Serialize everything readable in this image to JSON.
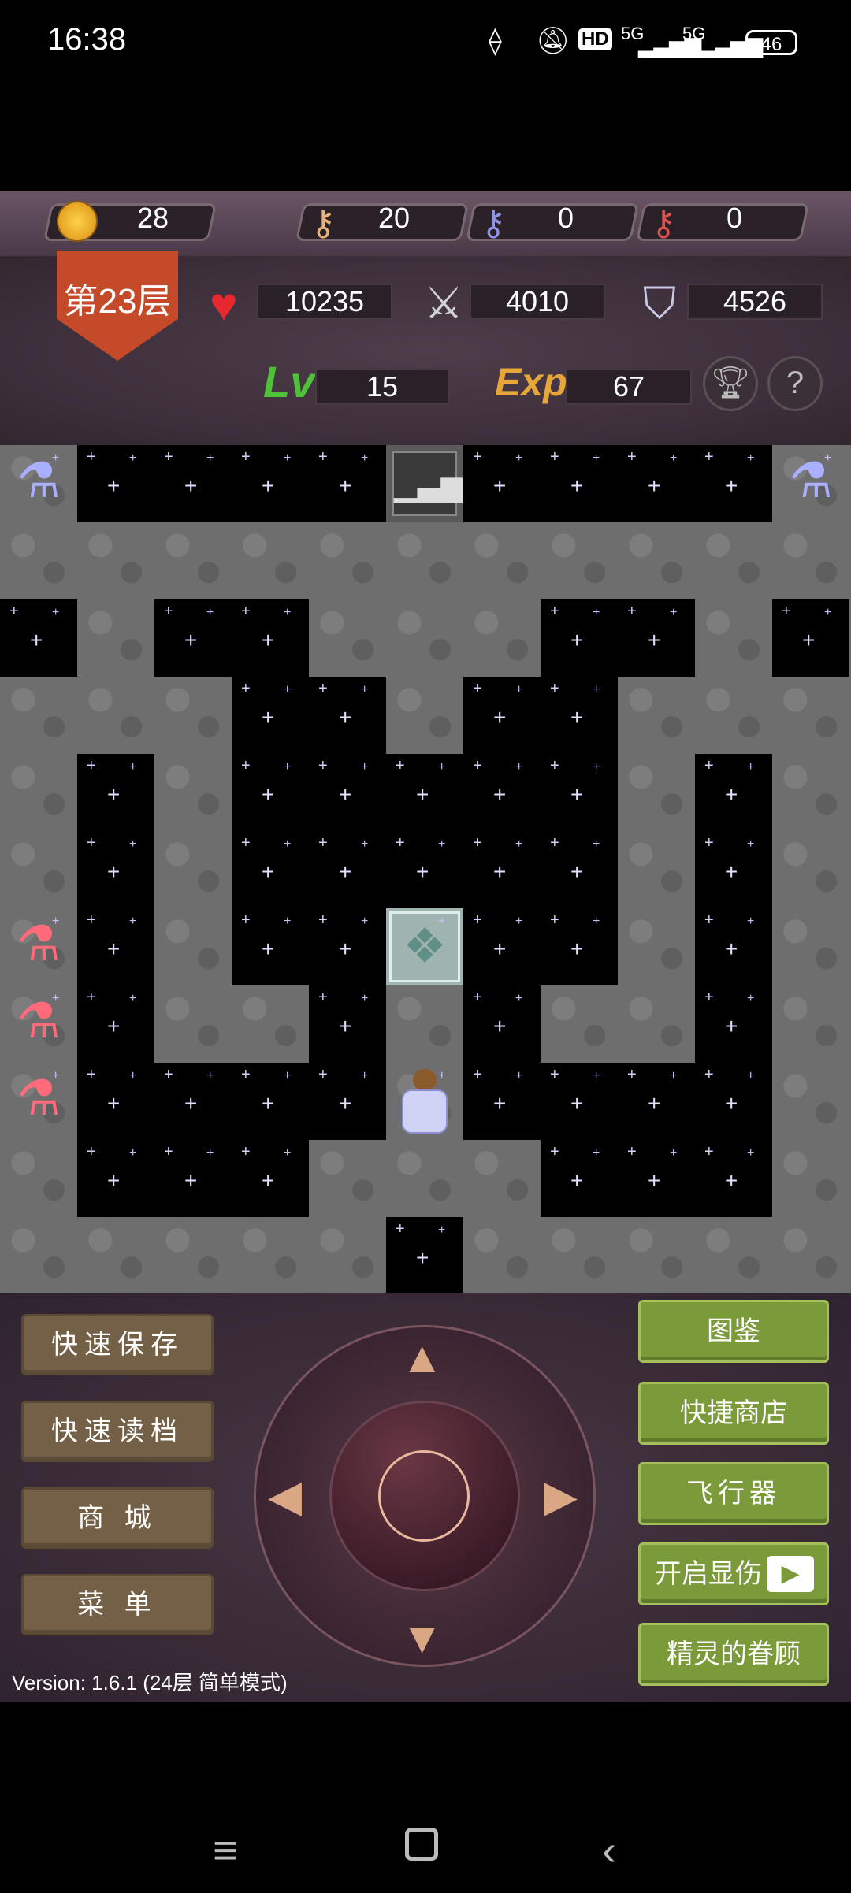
{
  "status_bar": {
    "time": "16:38",
    "hd_badge": "HD",
    "network_1": "5G",
    "network_2": "5G",
    "battery": "46"
  },
  "resources": {
    "gold": "28",
    "yellow_keys": "20",
    "blue_keys": "0",
    "red_keys": "0",
    "colors": {
      "yellow_key": "#e8b07a",
      "blue_key": "#8f94e6",
      "red_key": "#d9534f"
    }
  },
  "hero": {
    "floor": "第23层",
    "hp": "10235",
    "attack": "4010",
    "defense": "4526",
    "level_label": "Lv",
    "level": "15",
    "exp_label": "Exp",
    "exp": "67"
  },
  "board": {
    "map_rows": [
      "PSSSSUSSSSP",
      "WWWWWWWWWWW",
      "SWSSWWWSSWS",
      "WWWSSWSSWWW",
      "WSWSSSSSWSW",
      "WSWSSSSSWSW",
      "RSWSSGSSWSW",
      "RSWWSWSWWSW",
      "RSSSSHSSSSW",
      "WSSSWWWSSSW",
      "WWWWWSWWWWW"
    ],
    "legend": {
      "W": "stone-wall",
      "S": "starry-space",
      "P": "blue-potion",
      "R": "red-potion",
      "U": "stairs-up",
      "G": "gate",
      "H": "hero"
    }
  },
  "controls": {
    "left_buttons": [
      "快速保存",
      "快速读档",
      "商 城",
      "菜 单"
    ],
    "right_buttons": [
      "图鉴",
      "快捷商店",
      "飞行器",
      "开启显伤",
      "精灵的眷顾"
    ]
  },
  "version": "Version: 1.6.1 (24层 简单模式)"
}
